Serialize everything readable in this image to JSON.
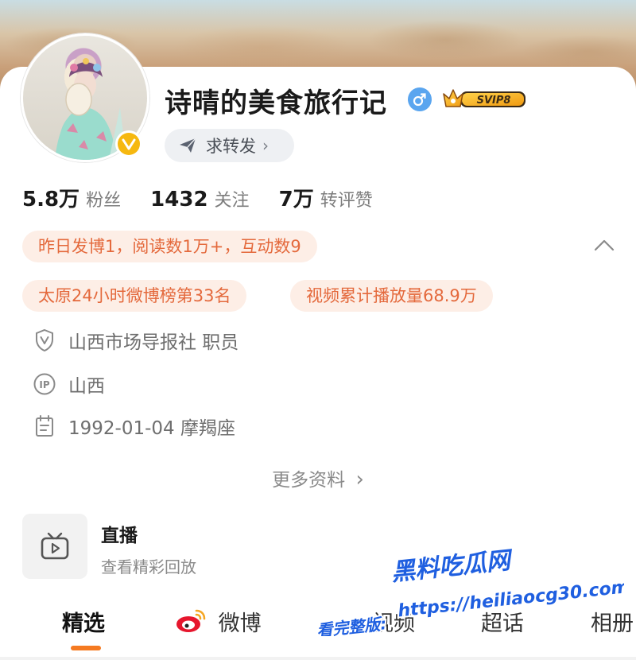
{
  "profile": {
    "name": "诗晴的美食旅行记",
    "gender_icon": "male-icon",
    "vip_badge": "SVIP8",
    "repost_label": "求转发",
    "repost_arrow": "›"
  },
  "stats": [
    {
      "value": "5.8万",
      "label": "粉丝"
    },
    {
      "value": "1432",
      "label": "关注"
    },
    {
      "value": "7万",
      "label": "转评赞"
    }
  ],
  "highlights": {
    "activity": "昨日发博1，阅读数1万+，互动数9",
    "rank": "太原24小时微博榜第33名",
    "video": "视频累计播放量68.9万"
  },
  "info": {
    "employer": "山西市场导报社 职员",
    "ip_location": "山西",
    "birthday": "1992-01-04 摩羯座"
  },
  "more_info_label": "更多资料",
  "more_info_arrow": "›",
  "live": {
    "title": "直播",
    "subtitle": "查看精彩回放"
  },
  "tabs": [
    {
      "label": "精选",
      "active": true
    },
    {
      "label": "微博"
    },
    {
      "label": "视频"
    },
    {
      "label": "超话"
    },
    {
      "label": "相册"
    }
  ],
  "watermark": {
    "title": "黑料吃瓜网",
    "prefix": "看完整版:",
    "url": "https://heiliaocg30.com"
  },
  "colors": {
    "accent": "#f57a21",
    "pill_bg": "#fdeee6",
    "pill_text": "#e4693c",
    "verified": "#f6b810",
    "gender": "#5aa5ef",
    "watermark": "#1f5fe0"
  }
}
